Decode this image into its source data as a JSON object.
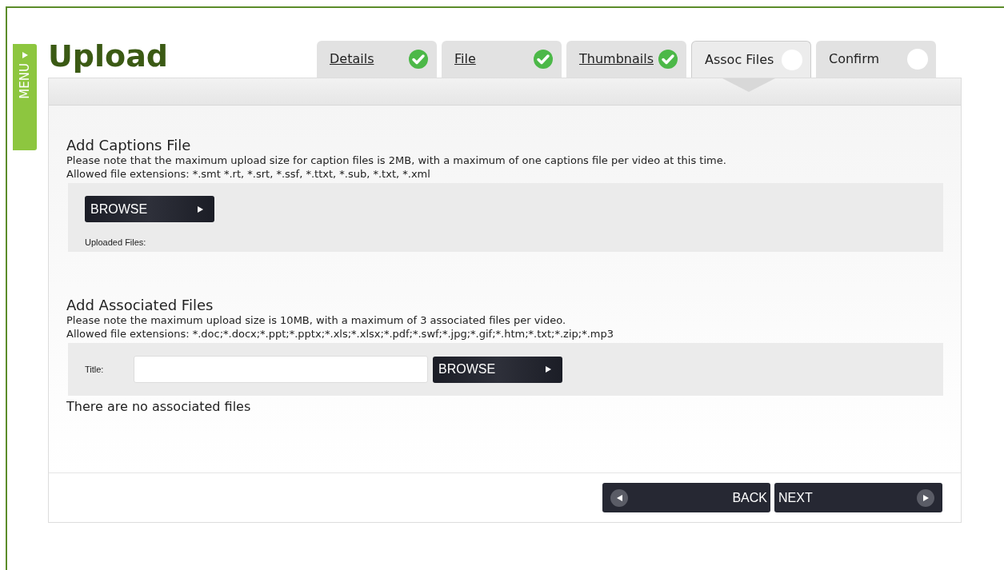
{
  "menu": {
    "label": "MENU"
  },
  "title": "Upload",
  "tabs": [
    {
      "label": "Details",
      "done": true,
      "selected": false
    },
    {
      "label": "File",
      "done": true,
      "selected": false
    },
    {
      "label": "Thumbnails",
      "done": true,
      "selected": false
    },
    {
      "label": "Assoc Files",
      "done": false,
      "selected": true
    },
    {
      "label": "Confirm",
      "done": false,
      "selected": false
    }
  ],
  "captions": {
    "heading": "Add Captions File",
    "note": "Please note that the maximum upload size for caption files is 2MB, with a maximum of one captions file per video at this time.",
    "extensions": "Allowed file extensions: *.smt *.rt, *.srt, *.ssf, *.ttxt, *.sub, *.txt, *.xml",
    "browse": "BROWSE",
    "uploaded_label": "Uploaded Files:"
  },
  "associated": {
    "heading": "Add Associated Files",
    "note": "Please note the maximum upload size is 10MB, with a maximum of 3 associated files per video.",
    "extensions": "Allowed file extensions: *.doc;*.docx;*.ppt;*.pptx;*.xls;*.xlsx;*.pdf;*.swf;*.jpg;*.gif;*.htm;*.txt;*.zip;*.mp3",
    "title_label": "Title:",
    "browse": "BROWSE",
    "empty_message": "There are no associated files"
  },
  "footer": {
    "back": "BACK",
    "next": "NEXT"
  }
}
